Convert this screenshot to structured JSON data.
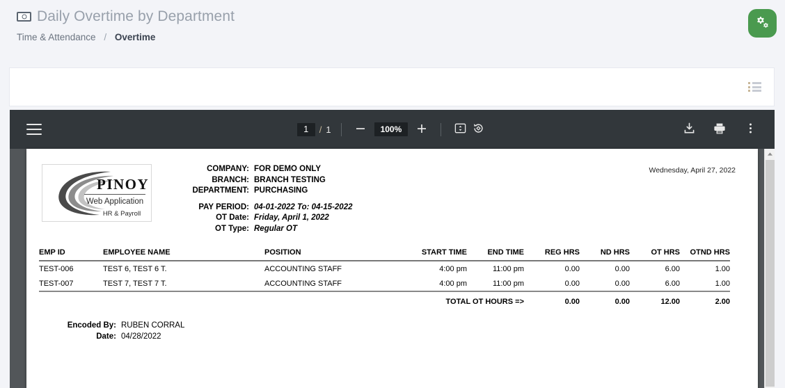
{
  "header": {
    "icon": "money-bill-icon",
    "title": "Daily Overtime by Department",
    "breadcrumb": {
      "parent": "Time & Attendance",
      "separator": "/",
      "current": "Overtime"
    },
    "fab": {
      "icon": "gears-icon",
      "color": "#4a9a4f"
    }
  },
  "card_strip": {
    "icon": "list-options-icon"
  },
  "pdf_toolbar": {
    "menu_icon": "hamburger-menu-icon",
    "page_current": "1",
    "page_separator": "/",
    "page_total": "1",
    "zoom_out_icon": "minus-icon",
    "zoom_level": "100%",
    "zoom_in_icon": "plus-icon",
    "fit_icon": "fit-to-page-icon",
    "rotate_icon": "rotate-counterclockwise-icon",
    "download_icon": "download-icon",
    "print_icon": "print-icon",
    "more_icon": "more-vertical-icon",
    "background": "#32373b"
  },
  "report": {
    "logo": {
      "brand": "PINOY",
      "line2": "Web Application",
      "line3": "HR & Payroll"
    },
    "printed_date": "Wednesday, April 27, 2022",
    "fields": [
      {
        "label": "COMPANY:",
        "value": "FOR DEMO ONLY",
        "italic": false
      },
      {
        "label": "BRANCH:",
        "value": "BRANCH TESTING",
        "italic": false
      },
      {
        "label": "DEPARTMENT:",
        "value": "PURCHASING",
        "italic": false
      }
    ],
    "fields2": [
      {
        "label": "PAY PERIOD:",
        "value": "04-01-2022 To: 04-15-2022",
        "italic": true
      },
      {
        "label": "OT Date:",
        "value": "Friday, April 1, 2022",
        "italic": true
      },
      {
        "label": "OT Type:",
        "value": "Regular OT",
        "italic": true
      }
    ],
    "table": {
      "columns": [
        "EMP ID",
        "EMPLOYEE NAME",
        "POSITION",
        "START TIME",
        "END TIME",
        "REG HRS",
        "ND HRS",
        "OT HRS",
        "OTND HRS"
      ],
      "rows": [
        {
          "emp_id": "TEST-006",
          "employee_name": "TEST 6, TEST 6 T.",
          "position": "ACCOUNTING STAFF",
          "start_time": "4:00 pm",
          "end_time": "11:00 pm",
          "reg_hrs": "0.00",
          "nd_hrs": "0.00",
          "ot_hrs": "6.00",
          "otnd_hrs": "1.00"
        },
        {
          "emp_id": "TEST-007",
          "employee_name": "TEST 7, TEST 7 T.",
          "position": "ACCOUNTING STAFF",
          "start_time": "4:00 pm",
          "end_time": "11:00 pm",
          "reg_hrs": "0.00",
          "nd_hrs": "0.00",
          "ot_hrs": "6.00",
          "otnd_hrs": "1.00"
        }
      ],
      "totals": {
        "label": "TOTAL OT HOURS =>",
        "reg_hrs": "0.00",
        "nd_hrs": "0.00",
        "ot_hrs": "12.00",
        "otnd_hrs": "2.00"
      }
    },
    "footer": [
      {
        "label": "Encoded By:",
        "value": "RUBEN CORRAL"
      },
      {
        "label": "Date:",
        "value": "04/28/2022"
      }
    ]
  }
}
